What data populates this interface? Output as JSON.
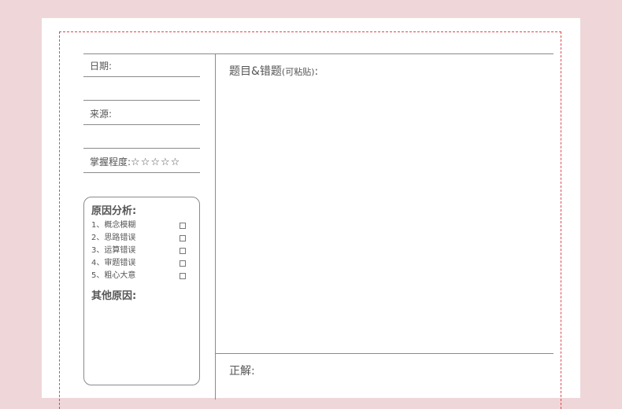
{
  "form": {
    "date_label": "日期:",
    "source_label": "来源:",
    "mastery_label": "掌握程度:",
    "mastery_stars": "☆☆☆☆☆",
    "mastery_rating": 0,
    "mastery_max": 5
  },
  "cause_analysis": {
    "title": "原因分析:",
    "items": [
      {
        "label": "1、概念模糊"
      },
      {
        "label": "2、思路错误"
      },
      {
        "label": "3、运算错误"
      },
      {
        "label": "4、审题错误"
      },
      {
        "label": "5、粗心大意"
      }
    ],
    "other_title": "其他原因:"
  },
  "question": {
    "label": "题目&错题",
    "note": "(可粘贴)",
    "colon": ":"
  },
  "answer": {
    "label": "正解:"
  },
  "colors": {
    "background": "#efd6d8",
    "dashed_border": "#e0474f",
    "line": "#8a8a8a"
  }
}
